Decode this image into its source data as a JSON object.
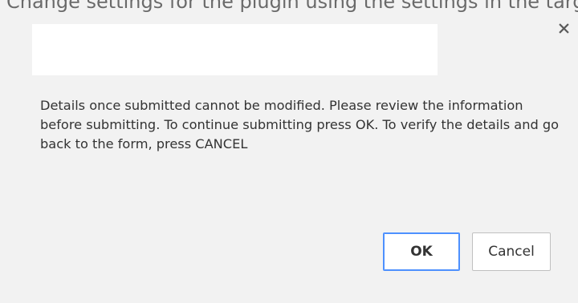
{
  "top_strip": {
    "text": "Change settings for the plugin using the settings in the target application"
  },
  "dialog": {
    "close_symbol": "×",
    "message": "Details once submitted cannot be modified. Please review the information before submitting. To continue submitting press OK. To verify the details and go back to the form, press CANCEL",
    "ok_label": "OK",
    "cancel_label": "Cancel"
  },
  "colors": {
    "background": "#f2f2f2",
    "focus_border": "#4d90fe"
  },
  "icons": {
    "close": "close-icon"
  }
}
